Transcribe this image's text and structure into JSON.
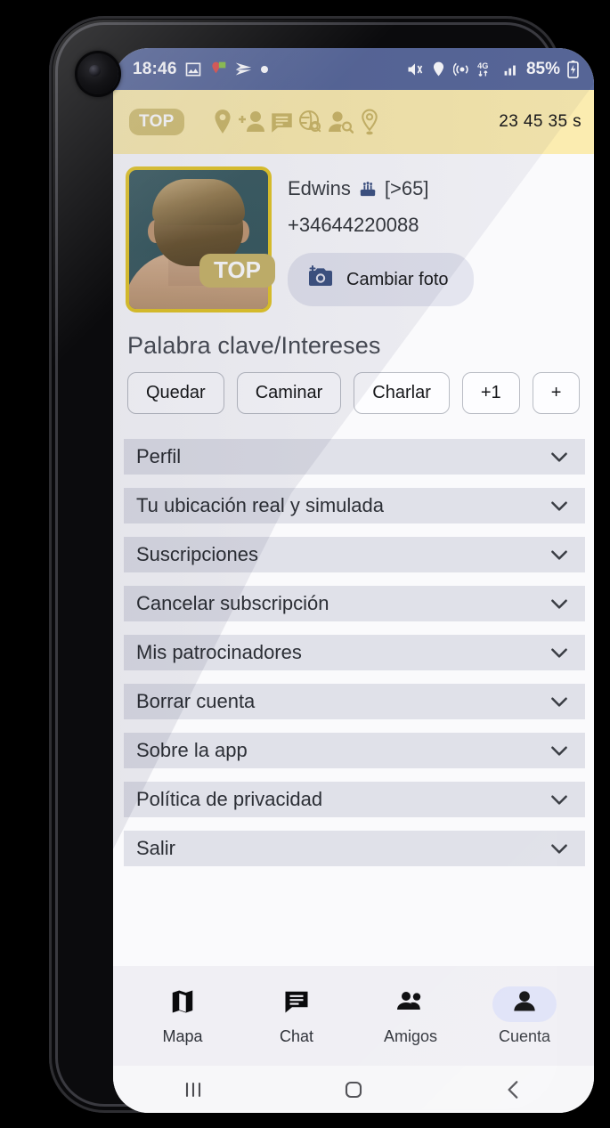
{
  "status_bar": {
    "time": "18:46",
    "battery_percent": "85%",
    "network": "4G",
    "left_icons": [
      "image-icon",
      "location-alert-icon",
      "send-icon",
      "dot-icon"
    ],
    "right_icons": [
      "mute-vibrate-icon",
      "location-icon",
      "hotspot-icon",
      "network-4g-icon",
      "signal-bars-icon",
      "battery-charging-icon"
    ],
    "background_color": "#5a6a9c"
  },
  "app_bar": {
    "badge": "TOP",
    "timer": "23 45 35 s",
    "background_color": "#fbecb0",
    "icons": [
      "location-pin-icon",
      "person-add-icon",
      "chat-icon",
      "globe-search-icon",
      "person-search-icon",
      "location-pin-outline-icon"
    ]
  },
  "profile": {
    "photo_badge": "TOP",
    "name": "Edwins",
    "age_badge": "[>65]",
    "age_icon": "birthday-cake-icon",
    "phone": "+34644220088",
    "change_photo_label": "Cambiar foto",
    "change_photo_icon": "camera-add-icon",
    "avatar_border_color": "#e4c82e"
  },
  "keywords": {
    "title": "Palabra clave/Intereses",
    "chips": [
      "Quedar",
      "Caminar",
      "Charlar",
      "+1",
      "+"
    ]
  },
  "accordion": {
    "items": [
      {
        "label": "Perfil"
      },
      {
        "label": "Tu ubicación real y simulada"
      },
      {
        "label": "Suscripciones"
      },
      {
        "label": "Cancelar subscripción"
      },
      {
        "label": "Mis patrocinadores"
      },
      {
        "label": "Borrar cuenta"
      },
      {
        "label": "Sobre la app"
      },
      {
        "label": "Política de privacidad"
      },
      {
        "label": "Salir"
      }
    ],
    "chevron_icon": "chevron-down-icon",
    "row_color": "#e0e1e9"
  },
  "bottom_nav": {
    "active_color": "#dfe2f8",
    "items": [
      {
        "label": "Mapa",
        "icon": "map-icon",
        "active": false
      },
      {
        "label": "Chat",
        "icon": "chat-icon",
        "active": false
      },
      {
        "label": "Amigos",
        "icon": "people-icon",
        "active": false
      },
      {
        "label": "Cuenta",
        "icon": "person-icon",
        "active": true
      }
    ]
  },
  "android_nav": {
    "recents": "recents-icon",
    "home": "home-icon",
    "back": "back-icon"
  }
}
